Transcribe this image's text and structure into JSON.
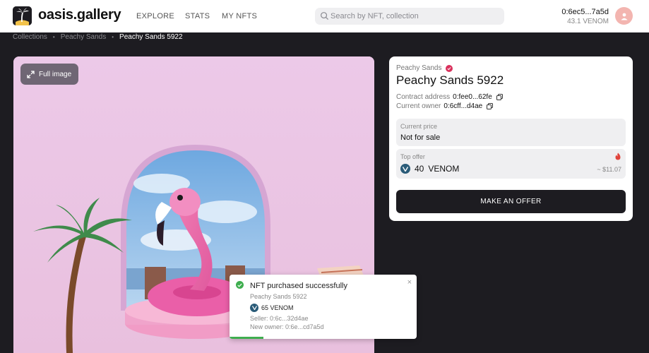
{
  "brand": {
    "name": "oasis.gallery"
  },
  "nav": [
    {
      "label": "EXPLORE"
    },
    {
      "label": "STATS"
    },
    {
      "label": "MY NFTS"
    }
  ],
  "search": {
    "placeholder": "Search by NFT, collection"
  },
  "wallet": {
    "address": "0:6ec5...7a5d",
    "balance": "43.1 VENOM"
  },
  "breadcrumb": {
    "collections": "Collections",
    "collection": "Peachy Sands",
    "current": "Peachy Sands 5922"
  },
  "image_panel": {
    "full_image_label": "Full image"
  },
  "nft": {
    "collection": "Peachy Sands",
    "title": "Peachy Sands 5922",
    "contract_label": "Contract address",
    "contract_value": "0:fee0...62fe",
    "owner_label": "Current owner",
    "owner_value": "0:6cff...d4ae",
    "current_price_label": "Current price",
    "current_price_value": "Not for sale",
    "top_offer_label": "Top offer",
    "top_offer_amount": "40",
    "top_offer_currency": "VENOM",
    "top_offer_usd": "~ $11.07",
    "make_offer_label": "MAKE AN OFFER"
  },
  "toast": {
    "title": "NFT purchased successfully",
    "subtitle": "Peachy Sands 5922",
    "price": "65 VENOM",
    "seller": "Seller: 0:6c...32d4ae",
    "new_owner": "New owner: 0:6e...cd7a5d",
    "close_glyph": "×",
    "progress": 0.18
  },
  "colors": {
    "background": "#1d1c21",
    "accent_verified": "#d9315c",
    "success": "#3fae4f",
    "image_bg": "#e9c9e4"
  }
}
